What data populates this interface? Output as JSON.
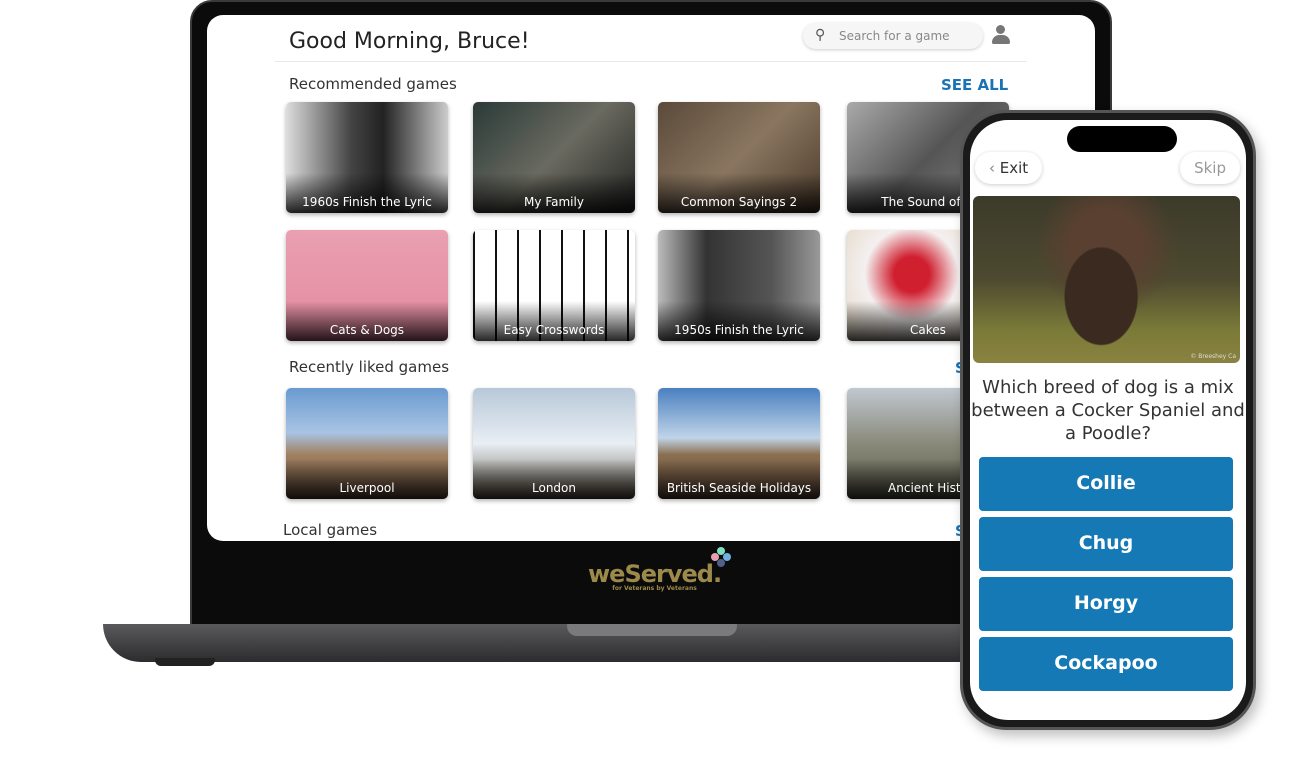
{
  "laptop": {
    "greeting": "Good Morning, Bruce!",
    "search": {
      "placeholder": "Search for a game",
      "icon": "search-icon"
    },
    "profile_icon": "user-icon",
    "sections": [
      {
        "title": "Recommended games",
        "see_all": "SEE ALL",
        "cards": [
          "1960s Finish the Lyric",
          "My Family",
          "Common Sayings 2",
          "The Sound of M",
          "Cats & Dogs",
          "Easy Crosswords",
          "1950s Finish the Lyric",
          "Cakes"
        ]
      },
      {
        "title": "Recently liked games",
        "see_all": "S",
        "cards": [
          "Liverpool",
          "London",
          "British Seaside Holidays",
          "Ancient Histo"
        ]
      },
      {
        "title": "Local games",
        "see_all": "S"
      }
    ],
    "logo": {
      "name": "weServed.",
      "tagline": "for Veterans by Veterans"
    }
  },
  "phone": {
    "exit": "Exit",
    "skip": "Skip",
    "image_credit": "© Breeshey Ca",
    "question": "Which breed of dog is a mix between a Cocker Spaniel and a Poodle?",
    "answers": [
      "Collie",
      "Chug",
      "Horgy",
      "Cockapoo"
    ],
    "answer_color": "#1479b4"
  }
}
